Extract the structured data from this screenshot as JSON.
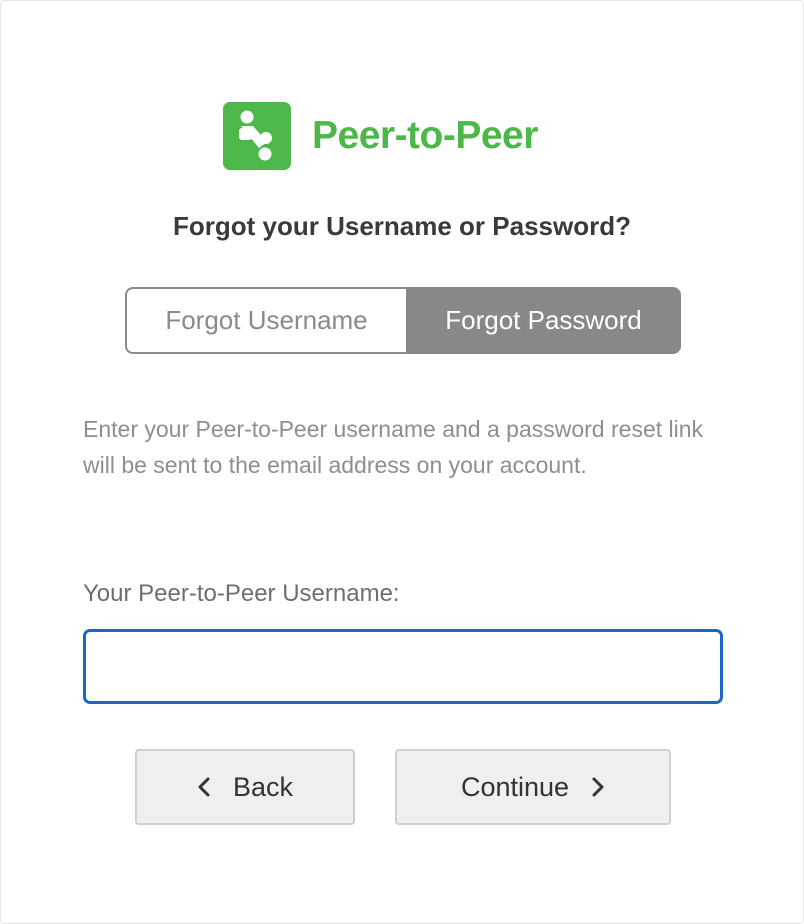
{
  "brand": {
    "name": "Peer-to-Peer",
    "color": "#4db74a"
  },
  "page_title": "Forgot your Username or Password?",
  "tabs": [
    {
      "label": "Forgot Username",
      "selected": false
    },
    {
      "label": "Forgot Password",
      "selected": true
    }
  ],
  "description": "Enter your Peer-to-Peer username and a password reset link will be sent to the email address on your account.",
  "username_field": {
    "label": "Your Peer-to-Peer Username:",
    "value": "",
    "placeholder": "",
    "focus_color": "#1a66c9"
  },
  "buttons": {
    "back": {
      "label": "Back",
      "icon": "chevron-left-icon"
    },
    "continue": {
      "label": "Continue",
      "icon": "chevron-right-icon"
    }
  }
}
